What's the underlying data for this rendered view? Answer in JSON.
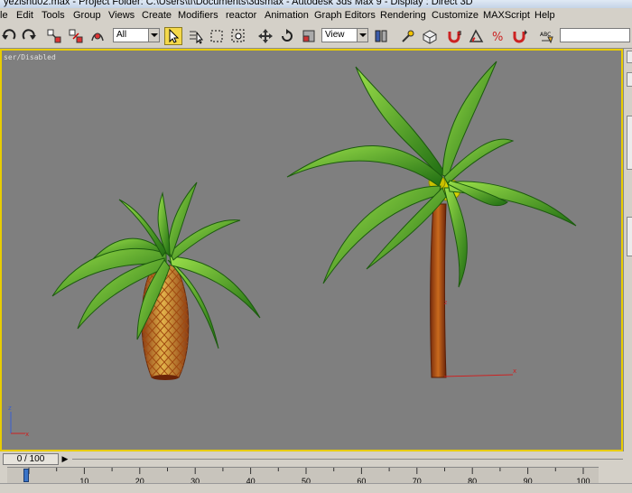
{
  "window": {
    "title": "yezishu02.max    - Project Folder: C:\\Users\\tf\\Documents\\3dsmax    - Autodesk 3ds Max 9    - Display : Direct 3D"
  },
  "menu": [
    "le",
    "Edit",
    "Tools",
    "Group",
    "Views",
    "Create",
    "Modifiers",
    "reactor",
    "Animation",
    "Graph Editors",
    "Rendering",
    "Customize",
    "MAXScript",
    "Help"
  ],
  "toolbar": {
    "selection_filter": "All",
    "reference_coord": "View",
    "named_selection_value": ""
  },
  "icons": {
    "undo": "undo-icon",
    "redo": "redo-icon",
    "link": "select-and-link-icon",
    "unlink": "unlink-icon",
    "bind": "bind-space-warp-icon",
    "select": "select-object-icon",
    "select_by_name": "select-by-name-icon",
    "region": "rectangular-region-icon",
    "window_crossing": "window-crossing-icon",
    "move": "select-and-move-icon",
    "rotate": "select-and-rotate-icon",
    "scale": "select-and-scale-icon",
    "pivot": "use-pivot-center-icon",
    "manipulate": "select-and-manipulate-icon",
    "keyboard_shortcut": "keyboard-shortcut-override-icon",
    "snap": "snaps-toggle-icon",
    "angle_snap": "angle-snap-icon",
    "percent_snap": "percent-snap-icon",
    "spinner_snap": "spinner-snap-icon",
    "edit_named": "edit-named-selection-icon"
  },
  "viewport": {
    "label": "ser/Disabled",
    "accent_color": "#e8cc00",
    "background_color": "#7f7f7f"
  },
  "timeline": {
    "frame_display": "0 / 100",
    "ticks": [
      "10",
      "20",
      "30",
      "40",
      "50",
      "60",
      "70",
      "80",
      "90",
      "100"
    ],
    "tick_min": 0,
    "tick_max": 100
  }
}
